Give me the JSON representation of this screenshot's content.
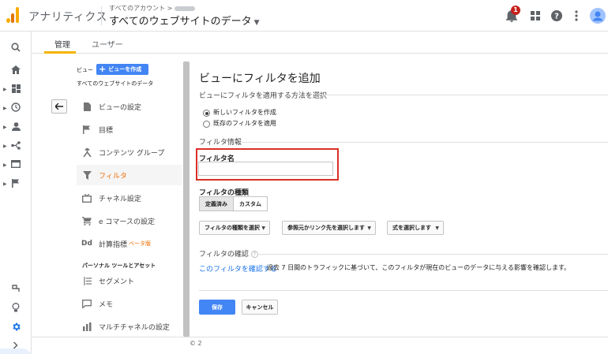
{
  "header": {
    "app_name": "アナリティクス",
    "breadcrumb": "すべてのアカウント >",
    "property_title": "すべてのウェブサイトのデータ",
    "notification_count": "1"
  },
  "tabs": [
    {
      "label": "管理",
      "active": true
    },
    {
      "label": "ユーザー",
      "active": false
    }
  ],
  "admin_nav": {
    "view_label": "ビュー",
    "create_view_label": "ビューを作成",
    "view_name": "すべてのウェブサイトのデータ",
    "items": [
      {
        "label": "ビューの設定",
        "icon": "document-icon",
        "active": false
      },
      {
        "label": "目標",
        "icon": "flag-icon",
        "active": false
      },
      {
        "label": "コンテンツ グループ",
        "icon": "content-group-icon",
        "active": false
      },
      {
        "label": "フィルタ",
        "icon": "filter-icon",
        "active": true
      },
      {
        "label": "チャネル設定",
        "icon": "channel-icon",
        "active": false
      },
      {
        "label": "e コマースの設定",
        "icon": "cart-icon",
        "active": false
      },
      {
        "label": "計算指標",
        "icon": "dd-icon",
        "active": false,
        "badge": "ベータ版"
      }
    ],
    "personal_section_label": "パーソナル ツールとアセット",
    "personal_items": [
      {
        "label": "セグメント",
        "icon": "segment-icon"
      },
      {
        "label": "メモ",
        "icon": "memo-icon"
      },
      {
        "label": "マルチチャネルの設定",
        "icon": "bar-chart-icon"
      }
    ]
  },
  "form": {
    "title": "ビューにフィルタを追加",
    "method_section": "ビューにフィルタを適用する方法を選択",
    "method_options": [
      {
        "label": "新しいフィルタを作成",
        "selected": true
      },
      {
        "label": "既存のフィルタを適用",
        "selected": false
      }
    ],
    "info_section": "フィルタ情報",
    "filter_name_label": "フィルタ名",
    "filter_name_value": "",
    "filter_type_label": "フィルタの種類",
    "filter_type_options": [
      {
        "label": "定義済み",
        "selected": true
      },
      {
        "label": "カスタム",
        "selected": false
      }
    ],
    "dropdowns": [
      {
        "label": "フィルタの種類を選択"
      },
      {
        "label": "参照元かリンク先を選択します"
      },
      {
        "label": "式を選択します"
      }
    ],
    "verify_label": "フィルタの確認",
    "verify_link": "このフィルタを確認する",
    "verify_text": "過去 7 日間のトラフィックに基づいて、このフィルタが現在のビューのデータに与える影響を確認します。",
    "save_label": "保存",
    "cancel_label": "キャンセル"
  },
  "footer": {
    "copyright": "© 2"
  },
  "colors": {
    "accent_blue": "#4285f4",
    "link_blue": "#1a73e8",
    "active_orange": "#ef6c00",
    "highlight_red": "#d93025",
    "tab_underline": "#f4b400"
  }
}
